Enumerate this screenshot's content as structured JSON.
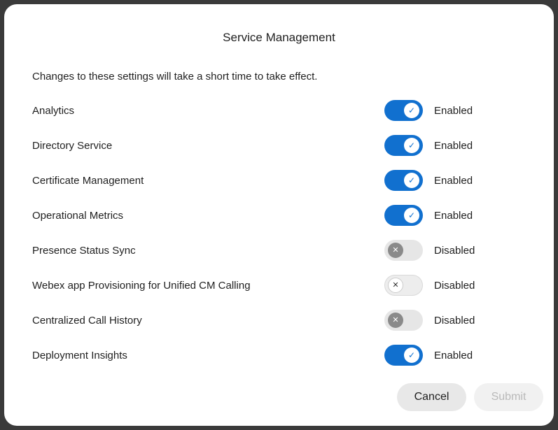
{
  "dialog": {
    "title": "Service Management",
    "subtitle": "Changes to these settings will take a short time to take effect."
  },
  "services": [
    {
      "label": "Analytics",
      "state": "Enabled"
    },
    {
      "label": "Directory Service",
      "state": "Enabled"
    },
    {
      "label": "Certificate Management",
      "state": "Enabled"
    },
    {
      "label": "Operational Metrics",
      "state": "Enabled"
    },
    {
      "label": "Presence Status Sync",
      "state": "Disabled"
    },
    {
      "label": "Webex app Provisioning for Unified CM Calling",
      "state": "Disabled"
    },
    {
      "label": "Centralized Call History",
      "state": "Disabled"
    },
    {
      "label": "Deployment Insights",
      "state": "Enabled"
    }
  ],
  "icons": {
    "on": "checkmark-icon",
    "off": "x-icon"
  },
  "colors": {
    "toggle_on": "#1170cf",
    "toggle_off_knob": "#8a8a8a"
  },
  "buttons": {
    "cancel": "Cancel",
    "submit": "Submit"
  }
}
